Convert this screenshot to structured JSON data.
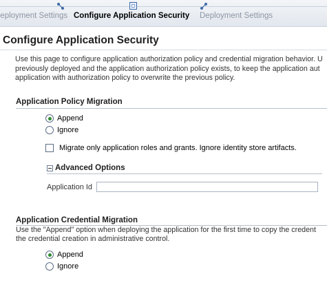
{
  "train": {
    "steps": [
      {
        "label": "Deployment Settings",
        "state": "previous"
      },
      {
        "label": "Configure Application Security",
        "state": "active"
      },
      {
        "label": "Deployment Settings",
        "state": "next"
      }
    ]
  },
  "page": {
    "title": "Configure Application Security",
    "intro_lines": [
      "Use this page to configure application authorization policy and credential migration behavior. U",
      "previously deployed and the application authorization policy exists, to keep the application aut",
      "application with authorization policy to overwrite the previous policy."
    ]
  },
  "policy_migration": {
    "title": "Application Policy Migration",
    "options": [
      {
        "label": "Append",
        "checked": true
      },
      {
        "label": "Ignore",
        "checked": false
      }
    ],
    "migrate_roles_label": "Migrate only application roles and grants. Ignore identity store artifacts.",
    "migrate_roles_checked": false,
    "advanced": {
      "title": "Advanced Options",
      "application_id_label": "Application Id",
      "application_id_value": ""
    }
  },
  "credential_migration": {
    "title": "Application Credential Migration",
    "desc_lines": [
      "Use the \"Append\" option when deploying the application for the first time to copy the credent",
      "the credential creation in administrative control."
    ],
    "options": [
      {
        "label": "Append",
        "checked": true
      },
      {
        "label": "Ignore",
        "checked": false
      }
    ]
  }
}
